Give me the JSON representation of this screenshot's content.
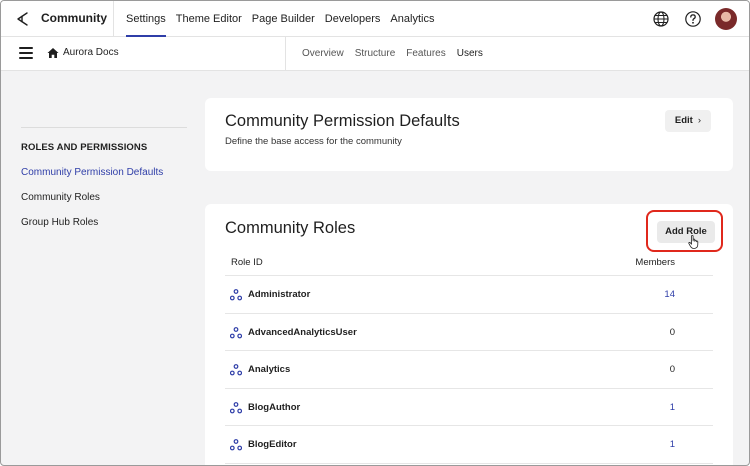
{
  "app": {
    "title": "Community"
  },
  "topnav": [
    {
      "label": "Settings",
      "active": true
    },
    {
      "label": "Theme Editor"
    },
    {
      "label": "Page Builder"
    },
    {
      "label": "Developers"
    },
    {
      "label": "Analytics"
    }
  ],
  "topbar_icons": [
    "globe-icon",
    "help-icon",
    "avatar"
  ],
  "subbar": {
    "site": "Aurora Docs"
  },
  "subnav": [
    {
      "label": "Overview"
    },
    {
      "label": "Structure"
    },
    {
      "label": "Features"
    },
    {
      "label": "Users",
      "active": true
    }
  ],
  "sidebar": {
    "heading": "ROLES AND PERMISSIONS",
    "items": [
      {
        "label": "Community Permission Defaults",
        "active": true
      },
      {
        "label": "Community Roles"
      },
      {
        "label": "Group Hub Roles"
      }
    ]
  },
  "defaults_card": {
    "title": "Community Permission Defaults",
    "description": "Define the base access for the community",
    "edit_label": "Edit",
    "edit_chevron": "›"
  },
  "roles_card": {
    "title": "Community Roles",
    "add_label": "Add Role",
    "columns": {
      "role": "Role ID",
      "members": "Members"
    },
    "rows": [
      {
        "name": "Administrator",
        "members": "14",
        "link": true
      },
      {
        "name": "AdvancedAnalyticsUser",
        "members": "0",
        "link": false
      },
      {
        "name": "Analytics",
        "members": "0",
        "link": false
      },
      {
        "name": "BlogAuthor",
        "members": "1",
        "link": true
      },
      {
        "name": "BlogEditor",
        "members": "1",
        "link": true
      }
    ]
  },
  "colors": {
    "accent": "#2f3ea8",
    "highlight": "#e0281c",
    "background": "#f3f3f4"
  }
}
